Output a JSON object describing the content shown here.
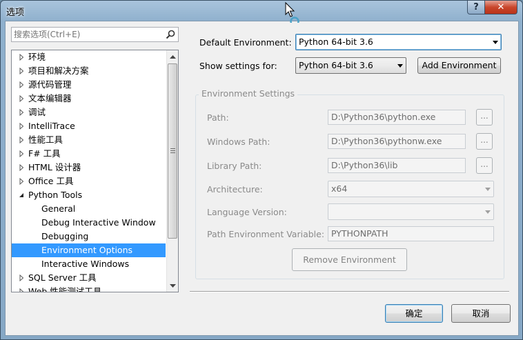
{
  "window": {
    "title": "选项"
  },
  "titlebar": {
    "help_label": "?",
    "close_label": "✕"
  },
  "search": {
    "placeholder": "搜索选项(Ctrl+E)"
  },
  "tree": {
    "items": [
      {
        "label": "环境",
        "level": 0,
        "expanded": false,
        "selected": false
      },
      {
        "label": "项目和解决方案",
        "level": 0,
        "expanded": false,
        "selected": false
      },
      {
        "label": "源代码管理",
        "level": 0,
        "expanded": false,
        "selected": false
      },
      {
        "label": "文本编辑器",
        "level": 0,
        "expanded": false,
        "selected": false
      },
      {
        "label": "调试",
        "level": 0,
        "expanded": false,
        "selected": false
      },
      {
        "label": "IntelliTrace",
        "level": 0,
        "expanded": false,
        "selected": false
      },
      {
        "label": "性能工具",
        "level": 0,
        "expanded": false,
        "selected": false
      },
      {
        "label": "F# 工具",
        "level": 0,
        "expanded": false,
        "selected": false
      },
      {
        "label": "HTML 设计器",
        "level": 0,
        "expanded": false,
        "selected": false
      },
      {
        "label": "Office 工具",
        "level": 0,
        "expanded": false,
        "selected": false
      },
      {
        "label": "Python Tools",
        "level": 0,
        "expanded": true,
        "selected": false
      },
      {
        "label": "General",
        "level": 1,
        "expanded": false,
        "selected": false
      },
      {
        "label": "Debug Interactive Window",
        "level": 1,
        "expanded": false,
        "selected": false
      },
      {
        "label": "Debugging",
        "level": 1,
        "expanded": false,
        "selected": false
      },
      {
        "label": "Environment Options",
        "level": 1,
        "expanded": false,
        "selected": true
      },
      {
        "label": "Interactive Windows",
        "level": 1,
        "expanded": false,
        "selected": false
      },
      {
        "label": "SQL Server 工具",
        "level": 0,
        "expanded": false,
        "selected": false
      },
      {
        "label": "Web 性能测试工具",
        "level": 0,
        "expanded": false,
        "selected": false
      }
    ]
  },
  "default_env": {
    "label": "Default Environment:",
    "value": "Python 64-bit 3.6"
  },
  "show_settings": {
    "label": "Show settings for:",
    "value": "Python 64-bit 3.6"
  },
  "add_env_button": {
    "label": "Add Environment"
  },
  "env_settings": {
    "title": "Environment Settings",
    "path": {
      "label": "Path:",
      "value": "D:\\Python36\\python.exe"
    },
    "windows_path": {
      "label": "Windows Path:",
      "value": "D:\\Python36\\pythonw.exe"
    },
    "library_path": {
      "label": "Library Path:",
      "value": "D:\\Python36\\lib"
    },
    "architecture": {
      "label": "Architecture:",
      "value": "x64"
    },
    "language_version": {
      "label": "Language Version:",
      "value": ""
    },
    "path_env_var": {
      "label": "Path Environment Variable:",
      "value": "PYTHONPATH"
    },
    "browse_label": "...",
    "remove_button": "Remove Environment"
  },
  "footer": {
    "ok_label": "确定",
    "cancel_label": "取消"
  },
  "colors": {
    "selection": "#3399ff",
    "close_button": "#c9462c",
    "primary_border": "#3c7fb1"
  }
}
